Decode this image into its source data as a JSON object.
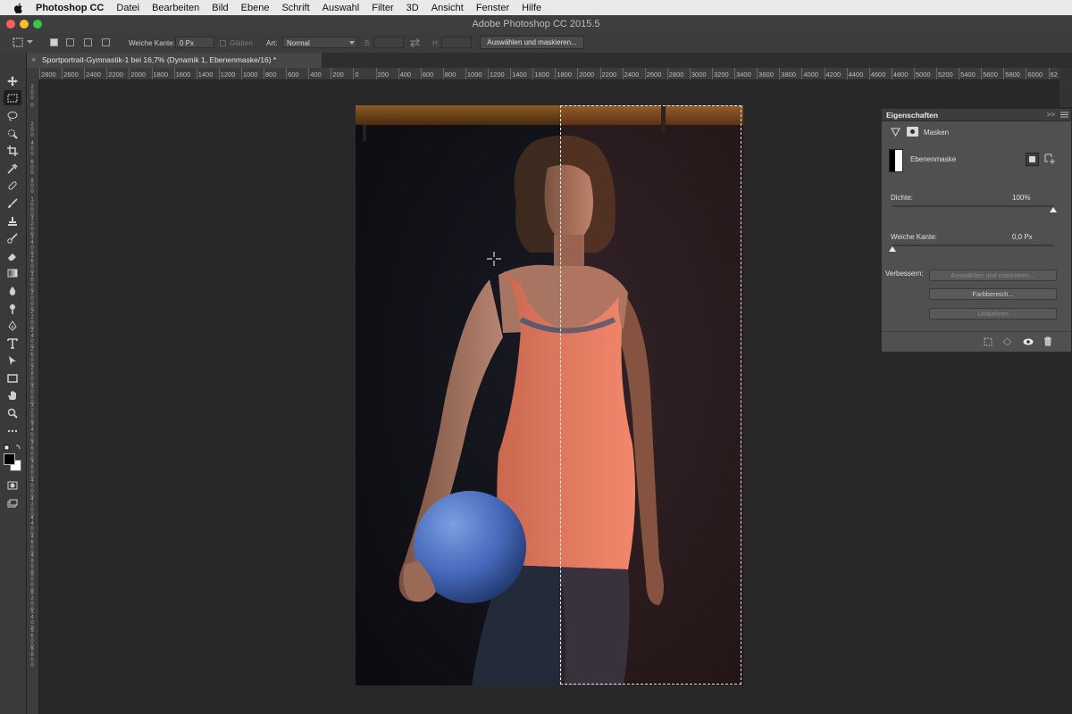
{
  "menubar": {
    "app_name": "Photoshop CC",
    "items": [
      "Datei",
      "Bearbeiten",
      "Bild",
      "Ebene",
      "Schrift",
      "Auswahl",
      "Filter",
      "3D",
      "Ansicht",
      "Fenster",
      "Hilfe"
    ]
  },
  "window": {
    "title": "Adobe Photoshop CC 2015.5"
  },
  "options": {
    "feather_label": "Weiche Kante:",
    "feather_value": "0 Px",
    "antialias_label": "Glätten",
    "style_label": "Art:",
    "style_value": "Normal",
    "width_label": "B:",
    "height_label": "H:",
    "select_mask_button": "Auswählen und maskieren..."
  },
  "document": {
    "tab_close": "×",
    "tab_title": "Sportportrait-Gymnastik-1 bei 16,7% (Dynamik 1, Ebenenmaske/16) *"
  },
  "ruler": {
    "h_ticks": [
      "2800",
      "2600",
      "2400",
      "2200",
      "2000",
      "1800",
      "1600",
      "1400",
      "1200",
      "1000",
      "800",
      "600",
      "400",
      "200",
      "0",
      "200",
      "400",
      "600",
      "800",
      "1000",
      "1200",
      "1400",
      "1600",
      "1800",
      "2000",
      "2200",
      "2400",
      "2600",
      "2800",
      "3000",
      "3200",
      "3400",
      "3600",
      "3800",
      "4000",
      "4200",
      "4400",
      "4600",
      "4800",
      "5000",
      "5200",
      "5400",
      "5600",
      "5800",
      "6000",
      "62"
    ],
    "v_ticks": [
      "200",
      "0",
      "200",
      "400",
      "600",
      "800",
      "1000",
      "1200",
      "1400",
      "1600",
      "1800",
      "2000",
      "2200",
      "2400",
      "2600",
      "2800",
      "3000",
      "3200",
      "3400",
      "3600",
      "3800",
      "4000",
      "4200",
      "4400",
      "4600",
      "4800",
      "5000",
      "5200",
      "5400",
      "5600",
      "5800"
    ]
  },
  "properties": {
    "panel_title": "Eigenschaften",
    "collapse_glyph": ">>",
    "section": "Masken",
    "mask_name": "Ebenenmaske",
    "density_label": "Dichte:",
    "density_value": "100%",
    "density_level": 1.0,
    "feather_label": "Weiche Kante:",
    "feather_value": "0,0 Px",
    "feather_level": 0.0,
    "refine_label": "Verbessern:",
    "select_mask_button": "Auswählen und maskieren...",
    "color_range_button": "Farbbereich...",
    "invert_button": "Umkehren"
  },
  "colors": {
    "accent_traffic_close": "#fc5f57",
    "accent_traffic_min": "#fdbc2e",
    "accent_traffic_max": "#34c84a",
    "tank_top_left": "#f0856f",
    "tank_top_right": "#fa6a52"
  }
}
